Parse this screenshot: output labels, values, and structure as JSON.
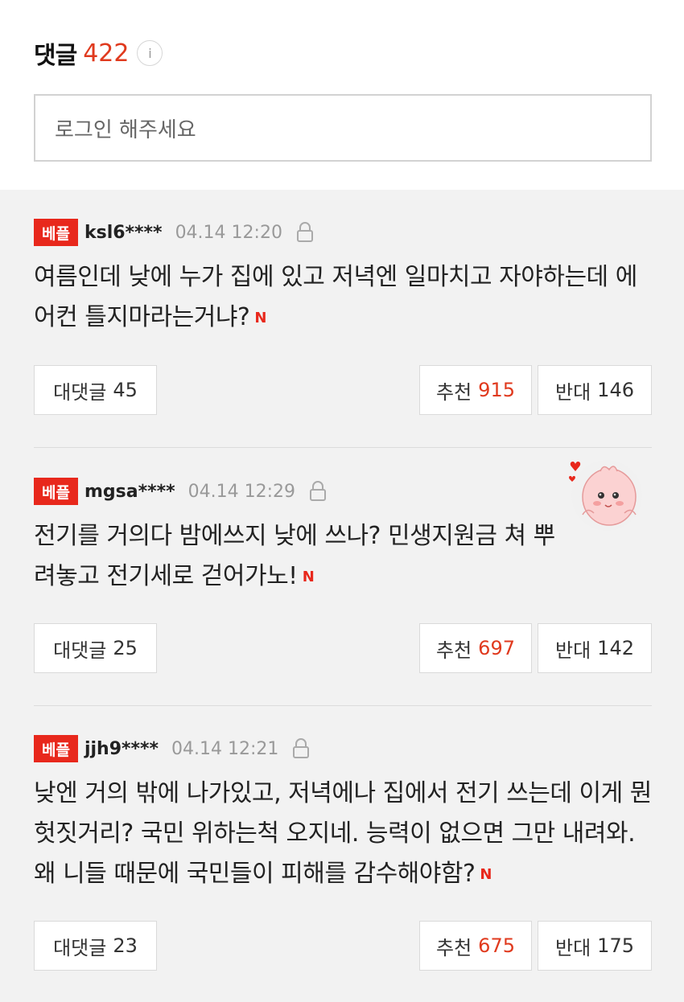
{
  "header": {
    "title": "댓글",
    "count": "422",
    "info_icon": "i"
  },
  "login": {
    "placeholder": "로그인 해주세요"
  },
  "comments": [
    {
      "badge": "베플",
      "user": "ksl6****",
      "time": "04.14 12:20",
      "text": "여름인데 낮에 누가 집에 있고 저녁엔 일마치고 자야하는데 에어컨 틀지마라는거냐?",
      "reply_label": "대댓글",
      "reply_count": "45",
      "like_label": "추천",
      "like_count": "915",
      "dislike_label": "반대",
      "dislike_count": "146"
    },
    {
      "badge": "베플",
      "user": "mgsa****",
      "time": "04.14 12:29",
      "text": "전기를 거의다 밤에쓰지 낮에 쓰나? 민생지원금 쳐 뿌려놓고 전기세로 걷어가노!",
      "reply_label": "대댓글",
      "reply_count": "25",
      "like_label": "추천",
      "like_count": "697",
      "dislike_label": "반대",
      "dislike_count": "142"
    },
    {
      "badge": "베플",
      "user": "jjh9****",
      "time": "04.14 12:21",
      "text": "낮엔 거의 밖에 나가있고, 저녁에나 집에서 전기 쓰는데 이게 뭔 헛짓거리? 국민 위하는척 오지네. 능력이 없으면 그만 내려와. 왜 니들 때문에 국민들이 피해를 감수해야함?",
      "reply_label": "대댓글",
      "reply_count": "23",
      "like_label": "추천",
      "like_count": "675",
      "dislike_label": "반대",
      "dislike_count": "175"
    }
  ],
  "n_icon": "N",
  "colors": {
    "accent": "#e8281c",
    "count_red": "#e03a1e"
  }
}
